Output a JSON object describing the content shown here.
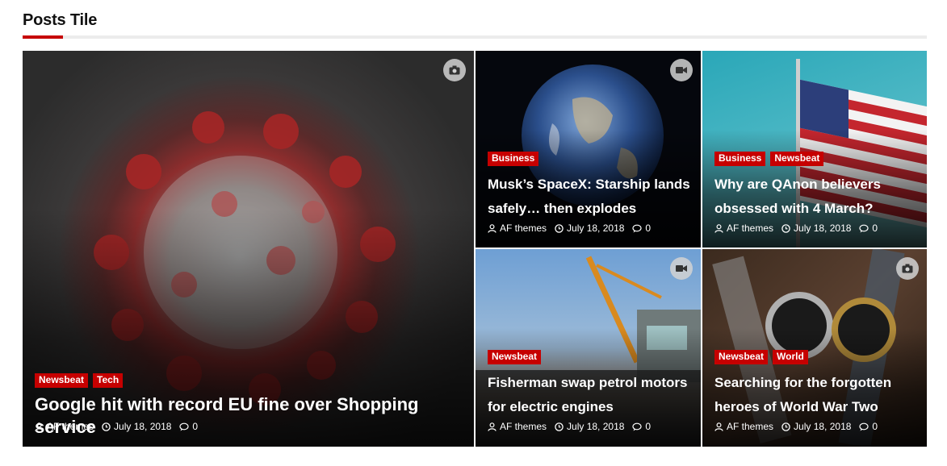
{
  "section": {
    "title": "Posts Tile"
  },
  "posts": [
    {
      "id": "big",
      "categories": [
        "Newsbeat",
        "Tech"
      ],
      "title": "Google hit with record EU fine over Shopping service",
      "author": "AF themes",
      "date": "July 18, 2018",
      "comments": "0",
      "media": "camera-icon"
    },
    {
      "id": "s1",
      "categories": [
        "Business"
      ],
      "title": "Musk’s SpaceX: Starship lands safely… then explodes",
      "author": "AF themes",
      "date": "July 18, 2018",
      "comments": "0",
      "media": "video-icon"
    },
    {
      "id": "s2",
      "categories": [
        "Business",
        "Newsbeat"
      ],
      "title": "Why are QAnon believers obsessed with 4 March?",
      "author": "AF themes",
      "date": "July 18, 2018",
      "comments": "0",
      "media": ""
    },
    {
      "id": "s3",
      "categories": [
        "Newsbeat"
      ],
      "title": "Fisherman swap petrol motors for electric engines",
      "author": "AF themes",
      "date": "July 18, 2018",
      "comments": "0",
      "media": "video-icon"
    },
    {
      "id": "s4",
      "categories": [
        "Newsbeat",
        "World"
      ],
      "title": "Searching for the forgotten heroes of World War Two",
      "author": "AF themes",
      "date": "July 18, 2018",
      "comments": "0",
      "media": "camera-icon"
    }
  ],
  "colors": {
    "accent": "#c60000",
    "category_bg": "#c60000"
  }
}
